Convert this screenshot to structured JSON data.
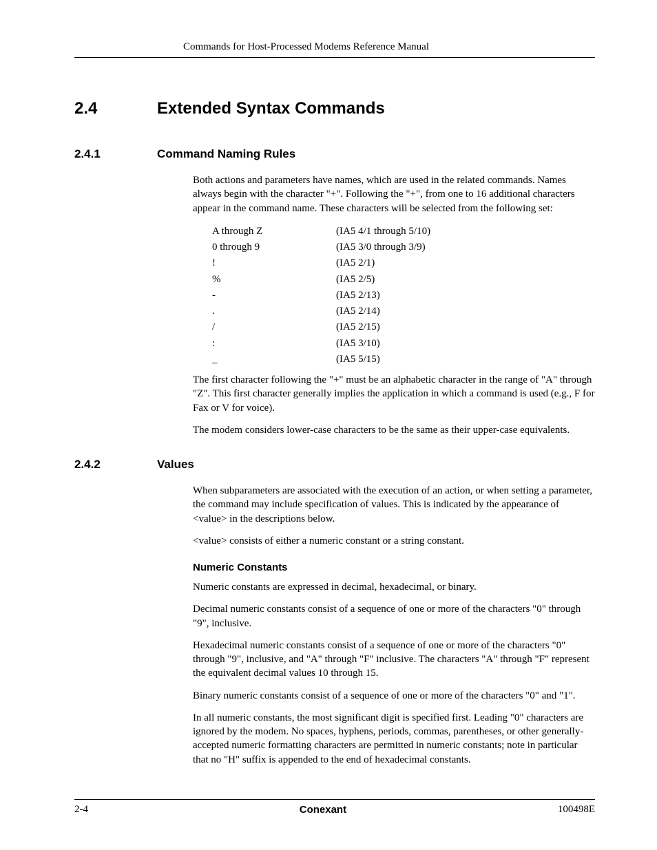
{
  "header": {
    "running_title": "Commands for Host-Processed Modems Reference Manual"
  },
  "s24": {
    "num": "2.4",
    "title": "Extended Syntax Commands"
  },
  "s241": {
    "num": "2.4.1",
    "title": "Command Naming Rules",
    "p1": "Both actions and parameters have names, which are used in the related commands. Names always begin with the character \"+\". Following the \"+\", from one to 16 additional characters appear in the command name. These characters will be selected from the following set:",
    "rows": [
      {
        "c": "A through Z",
        "d": "(IA5 4/1 through 5/10)"
      },
      {
        "c": "0 through 9",
        "d": "(IA5 3/0 through 3/9)"
      },
      {
        "c": "!",
        "d": "(IA5 2/1)"
      },
      {
        "c": "%",
        "d": "(IA5 2/5)"
      },
      {
        "c": "-",
        "d": "(IA5 2/13)"
      },
      {
        "c": ".",
        "d": "(IA5 2/14)"
      },
      {
        "c": "/",
        "d": "(IA5 2/15)"
      },
      {
        "c": ":",
        "d": "(IA5 3/10)"
      },
      {
        "c": "_",
        "d": "(IA5 5/15)"
      }
    ],
    "p2": "The first character following the \"+\" must be an alphabetic character in the range of \"A\" through \"Z\". This first character generally implies the application in which a command is used (e.g., F for Fax or V for voice).",
    "p3": "The modem considers lower-case characters to be the same as their upper-case equivalents."
  },
  "s242": {
    "num": "2.4.2",
    "title": "Values",
    "p1": "When subparameters are associated with the execution of an action, or when setting a parameter, the command may include specification of values. This is indicated by the appearance of <value> in the descriptions below.",
    "p2": "<value> consists of either a numeric constant or a string constant.",
    "numeric": {
      "heading": "Numeric Constants",
      "p1": "Numeric constants are expressed in decimal, hexadecimal, or binary.",
      "p2": "Decimal numeric constants consist of a sequence of one or more of the characters \"0\" through \"9\", inclusive.",
      "p3": "Hexadecimal numeric constants consist of a sequence of one or more of the characters \"0\" through \"9\", inclusive, and \"A\" through \"F\" inclusive. The characters \"A\" through \"F\" represent the equivalent decimal values 10 through 15.",
      "p4": "Binary numeric constants consist of a sequence of one or more of the characters \"0\" and \"1\".",
      "p5": "In all numeric constants, the most significant digit is specified first. Leading \"0\" characters are ignored by the modem. No spaces, hyphens, periods, commas, parentheses, or other generally-accepted numeric formatting characters are permitted in numeric constants; note in particular that no \"H\" suffix is appended to the end of hexadecimal constants."
    }
  },
  "footer": {
    "left": "2-4",
    "center": "Conexant",
    "right": "100498E"
  }
}
